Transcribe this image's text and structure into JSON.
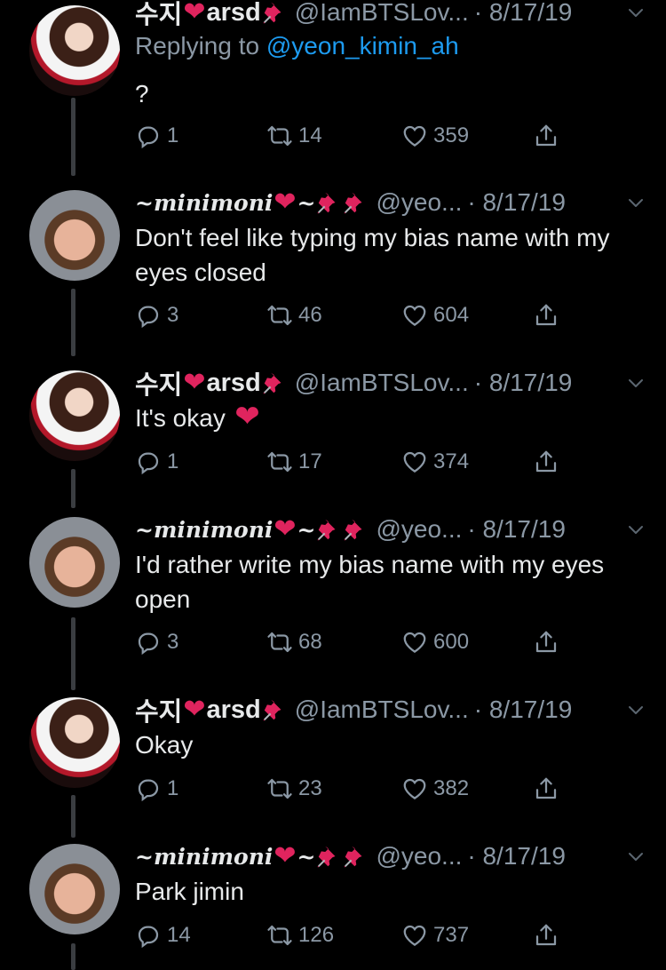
{
  "tweets": [
    {
      "author": "suzy",
      "name_prefix": "수지",
      "name_suffix": "arsd",
      "pins": 1,
      "handle": "@IamBTSLov...",
      "time": "· 8/17/19",
      "reply_label": "Replying to ",
      "reply_link": "@yeon_kimin_ah",
      "text": "?",
      "heart_after_text": false,
      "replies": "1",
      "retweets": "14",
      "likes": "359"
    },
    {
      "author": "moni",
      "name_prefix": "~minimoni",
      "name_suffix": "~",
      "pins": 2,
      "handle": "@yeo...",
      "time": "· 8/17/19",
      "text": "Don't feel like typing my bias name with my eyes closed",
      "heart_after_text": false,
      "replies": "3",
      "retweets": "46",
      "likes": "604"
    },
    {
      "author": "suzy",
      "name_prefix": "수지",
      "name_suffix": "arsd",
      "pins": 1,
      "handle": "@IamBTSLov...",
      "time": "· 8/17/19",
      "text": "It's okay",
      "heart_after_text": true,
      "replies": "1",
      "retweets": "17",
      "likes": "374"
    },
    {
      "author": "moni",
      "name_prefix": "~minimoni",
      "name_suffix": "~",
      "pins": 2,
      "handle": "@yeo...",
      "time": "· 8/17/19",
      "text": "I'd rather write my bias name with my eyes open",
      "heart_after_text": false,
      "replies": "3",
      "retweets": "68",
      "likes": "600"
    },
    {
      "author": "suzy",
      "name_prefix": "수지",
      "name_suffix": "arsd",
      "pins": 1,
      "handle": "@IamBTSLov...",
      "time": "· 8/17/19",
      "text": "Okay",
      "heart_after_text": false,
      "replies": "1",
      "retweets": "23",
      "likes": "382"
    },
    {
      "author": "moni",
      "name_prefix": "~minimoni",
      "name_suffix": "~",
      "pins": 2,
      "handle": "@yeo...",
      "time": "· 8/17/19",
      "text": "Park jimin",
      "heart_after_text": false,
      "replies": "14",
      "retweets": "126",
      "likes": "737"
    }
  ],
  "icons": {
    "reply": "reply-icon",
    "retweet": "retweet-icon",
    "like": "heart-outline-icon",
    "share": "share-icon",
    "more": "chevron-down-icon",
    "pin": "pushpin-emoji-icon",
    "heart": "red-heart-emoji-icon"
  },
  "colors": {
    "background": "#000000",
    "text": "#e7e9ea",
    "muted": "#8b98a5",
    "link": "#1d9bf0",
    "heart": "#e0245e"
  }
}
